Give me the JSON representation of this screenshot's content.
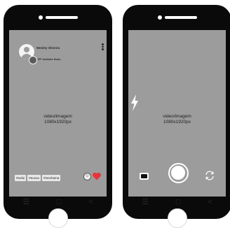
{
  "post_screen": {
    "username": "Wesley Oliveira",
    "organization": "IFF Instituto Nono",
    "placeholder_line1": "video/imagem",
    "placeholder_line2": "1080x1920px",
    "tags": [
      "#eufui",
      "#euvou",
      "#mechama"
    ],
    "icons": {
      "avatar": "user-avatar-icon",
      "more": "more-vertical-icon",
      "emoji": "smile-icon",
      "like": "heart-icon"
    },
    "colors": {
      "heart": "#e8323a",
      "screen": "#9c9c9c"
    }
  },
  "camera_screen": {
    "placeholder_line1": "video/imagem",
    "placeholder_line2": "1080x1920px",
    "icons": {
      "flash": "flash-icon",
      "gallery": "gallery-icon",
      "shutter": "shutter-button",
      "switch": "switch-camera-icon"
    }
  },
  "navbar": {
    "menu": "☰",
    "home": "□",
    "back": "<"
  }
}
